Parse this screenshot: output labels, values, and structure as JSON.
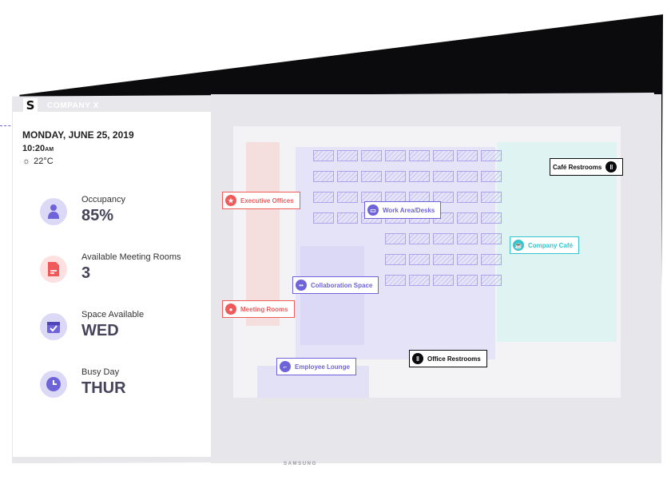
{
  "company": {
    "name": "COMPANY X"
  },
  "status": {
    "date": "MONDAY, JUNE 25, 2019",
    "time": "10:20",
    "time_suffix": "AM",
    "temperature": "22°C"
  },
  "stats": [
    {
      "label": "Occupancy",
      "value": "85%",
      "icon": "person-icon",
      "color": "#6e63d9",
      "bg": "#dcd9f7"
    },
    {
      "label": "Available Meeting Rooms",
      "value": "3",
      "icon": "document-icon",
      "color": "#ef5b5b",
      "bg": "#fde0e0"
    },
    {
      "label": "Space Available",
      "value": "WED",
      "icon": "calendar-check-icon",
      "color": "#6e63d9",
      "bg": "#dcd9f7"
    },
    {
      "label": "Busy Day",
      "value": "THUR",
      "icon": "clock-icon",
      "color": "#6e63d9",
      "bg": "#dcd9f7"
    }
  ],
  "map": {
    "labels": {
      "executive_offices": "Executive Offices",
      "meeting_rooms": "Meeting Rooms",
      "work_area": "Work Area/Desks",
      "collaboration_space": "Collaboration Space",
      "employee_lounge": "Employee Lounge",
      "office_restrooms": "Office Restrooms",
      "company_cafe": "Company Café",
      "cafe_restrooms": "Café Restrooms"
    }
  },
  "device": {
    "brand": "SAMSUNG"
  },
  "colors": {
    "accent": "#6e63d9",
    "alert": "#ef5b5b",
    "cafe": "#33c6cf",
    "dark": "#0b0b0d"
  }
}
